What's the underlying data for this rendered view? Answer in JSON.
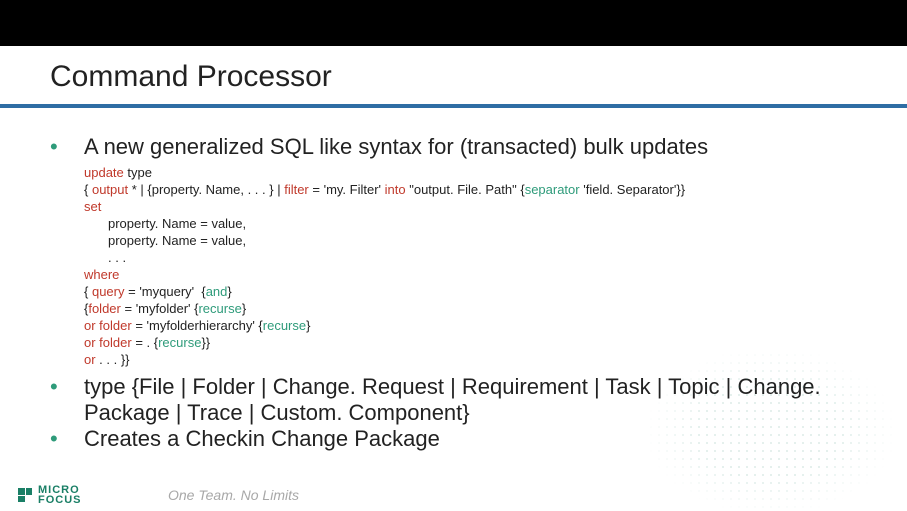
{
  "title": "Command Processor",
  "bullet1": "A new generalized SQL like syntax for (transacted) bulk updates",
  "code": {
    "l1a": "update",
    "l1b": " type",
    "l2a": "{ ",
    "l2b": "output",
    "l2c": " * | {property. Name, . . . } | ",
    "l2d": "filter",
    "l2e": " = 'my. Filter' ",
    "l2f": "into",
    "l2g": " \"output. File. Path\" {",
    "l2h": "separator",
    "l2i": " 'field. Separator'}}",
    "l3a": "set",
    "l4": "property. Name = value,",
    "l5": "property. Name = value,",
    "l6": ". . .",
    "l7a": "where",
    "l8a": "{ ",
    "l8b": "query",
    "l8c": " = 'myquery'  {",
    "l8d": "and",
    "l8e": "}",
    "l9a": "{",
    "l9b": "folder",
    "l9c": " = 'myfolder' {",
    "l9d": "recurse",
    "l9e": "}",
    "l10a": "or",
    "l10b": " folder",
    "l10c": " = 'myfolderhierarchy' {",
    "l10d": "recurse",
    "l10e": "}",
    "l11a": "or",
    "l11b": " folder",
    "l11c": " = . {",
    "l11d": "recurse",
    "l11e": "}}",
    "l12a": "or",
    "l12b": " . . . }}"
  },
  "bullet2": "type {File | Folder | Change. Request | Requirement | Task | Topic | Change. Package | Trace | Custom. Component}",
  "bullet3": "Creates a Checkin Change Package",
  "logo": {
    "line1": "MICRO",
    "line2": "FOCUS"
  },
  "tagline": "One Team. No Limits"
}
